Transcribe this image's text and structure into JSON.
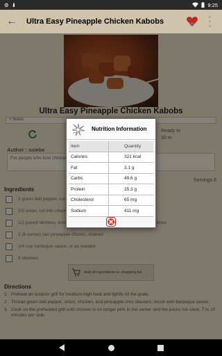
{
  "status_bar": {
    "time": "9:25"
  },
  "app_bar": {
    "title": "Ultra Easy Pineapple Chicken Kabobs"
  },
  "recipe": {
    "title": "Ultra Easy Pineapple Chicken Kabobs",
    "notes_tab": "+ Notes",
    "ready_label": "Ready In",
    "ready_value": "30 m",
    "author_label": "Author : ssiebe",
    "description": "For people who love chicken kabobs.",
    "servings": "Servings 6"
  },
  "ingredients": {
    "header": "Ingredients",
    "items": [
      "1 green bell pepper, cut into chunks",
      "1/2 onion, cut into chunks",
      "1/2 pound skinless, boneless chicken breast halves - cut into 1 inch pieces",
      "1 (8 ounce) can pineapple chunks, drained",
      "1/4 cup barbeque sauce, or as needed",
      "6 skewers"
    ],
    "add_button": "Add all ingredients to shopping list"
  },
  "directions": {
    "header": "Directions",
    "items": [
      {
        "num": "1",
        "text": "Preheat an outdoor grill for medium-high heat and lightly oil the grate."
      },
      {
        "num": "2",
        "text": "Thread green bell pepper, onion, chicken, and pineapple onto skewers; brush with barbeque sauce."
      },
      {
        "num": "3",
        "text": "Cook on the preheated grill until chicken is no longer pink in the center and the juices run clear, 7 to 10 minutes per side."
      }
    ]
  },
  "dialog": {
    "title": "Nutrition Information",
    "col_item": "Item",
    "col_quantity": "Quantity",
    "rows": [
      {
        "item": "Calories",
        "quantity": "321 kcal"
      },
      {
        "item": "Fat",
        "quantity": "3.1 g"
      },
      {
        "item": "Carbs",
        "quantity": "49.6 g"
      },
      {
        "item": "Protein",
        "quantity": "25.3 g"
      },
      {
        "item": "Cholesterol",
        "quantity": "65 mg"
      },
      {
        "item": "Sodium",
        "quantity": "411 mg"
      }
    ]
  },
  "colors": {
    "accent_red": "#c0281e",
    "background": "#e8dcc4"
  },
  "icons": [
    "settings-icon",
    "wifi-icon",
    "battery-icon",
    "back-arrow-icon",
    "heart-icon",
    "overflow-menu-icon",
    "refresh-icon",
    "cart-icon",
    "close-icon",
    "recipe-logo-icon"
  ]
}
